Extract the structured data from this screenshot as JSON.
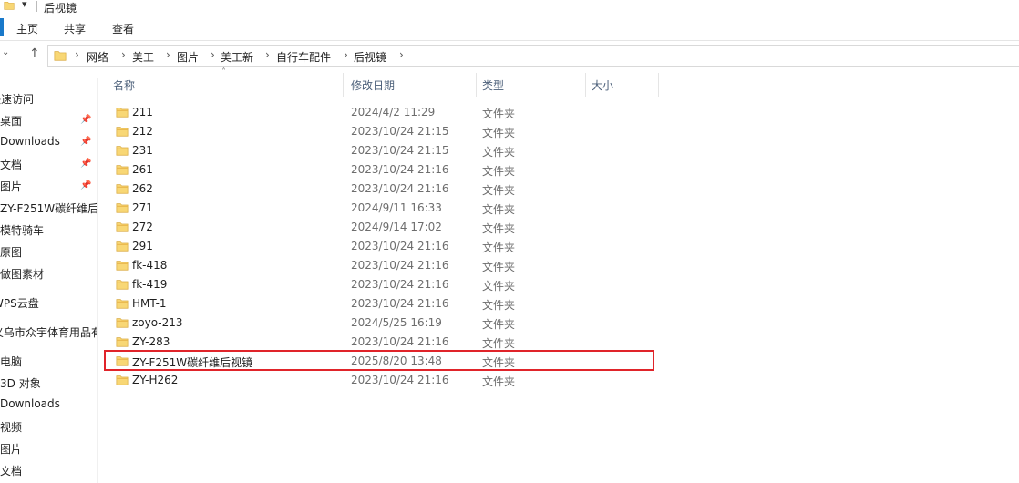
{
  "window": {
    "title": "后视镜"
  },
  "ribbon": {
    "tabs": [
      "主页",
      "共享",
      "查看"
    ]
  },
  "address": {
    "crumbs": [
      "网络",
      "美工",
      "图片",
      "美工新",
      "自行车配件",
      "后视镜"
    ]
  },
  "sidebar": {
    "items": [
      "快速访问",
      "桌面",
      "Downloads",
      "文档",
      "图片",
      "ZY-F251W碳纤维后",
      "模特骑车",
      "原图",
      "做图素材",
      "WPS云盘",
      "义乌市众宇体育用品有",
      "此电脑",
      "3D 对象",
      "Downloads",
      "视频",
      "图片",
      "文档"
    ]
  },
  "columns": {
    "name": "名称",
    "date": "修改日期",
    "type": "类型",
    "size": "大小"
  },
  "files": [
    {
      "name": "211",
      "date": "2024/4/2 11:29",
      "type": "文件夹"
    },
    {
      "name": "212",
      "date": "2023/10/24 21:15",
      "type": "文件夹"
    },
    {
      "name": "231",
      "date": "2023/10/24 21:15",
      "type": "文件夹"
    },
    {
      "name": "261",
      "date": "2023/10/24 21:16",
      "type": "文件夹"
    },
    {
      "name": "262",
      "date": "2023/10/24 21:16",
      "type": "文件夹"
    },
    {
      "name": "271",
      "date": "2024/9/11 16:33",
      "type": "文件夹"
    },
    {
      "name": "272",
      "date": "2024/9/14 17:02",
      "type": "文件夹"
    },
    {
      "name": "291",
      "date": "2023/10/24 21:16",
      "type": "文件夹"
    },
    {
      "name": "fk-418",
      "date": "2023/10/24 21:16",
      "type": "文件夹"
    },
    {
      "name": "fk-419",
      "date": "2023/10/24 21:16",
      "type": "文件夹"
    },
    {
      "name": "HMT-1",
      "date": "2023/10/24 21:16",
      "type": "文件夹"
    },
    {
      "name": "zoyo-213",
      "date": "2024/5/25 16:19",
      "type": "文件夹"
    },
    {
      "name": "ZY-283",
      "date": "2023/10/24 21:16",
      "type": "文件夹"
    },
    {
      "name": "ZY-F251W碳纤维后视镜",
      "date": "2025/8/20 13:48",
      "type": "文件夹"
    },
    {
      "name": "ZY-H262",
      "date": "2023/10/24 21:16",
      "type": "文件夹"
    }
  ],
  "colors": {
    "folder_body": "#f8d775",
    "folder_tab": "#e8b64c",
    "highlight": "#e0242a",
    "accent": "#1979ca"
  },
  "icons": {
    "folder": "folder-icon",
    "pin": "pin-icon"
  }
}
